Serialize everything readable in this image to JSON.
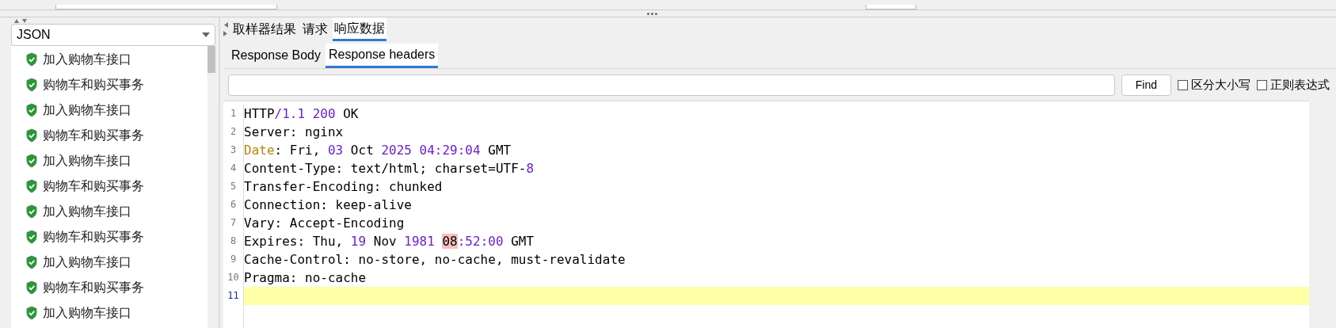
{
  "left_panel": {
    "renderer": {
      "value": "JSON"
    },
    "results": [
      {
        "label": "加入购物车接口",
        "passed": true
      },
      {
        "label": "购物车和购买事务",
        "passed": true
      },
      {
        "label": "加入购物车接口",
        "passed": true
      },
      {
        "label": "购物车和购买事务",
        "passed": true
      },
      {
        "label": "加入购物车接口",
        "passed": true
      },
      {
        "label": "购物车和购买事务",
        "passed": true
      },
      {
        "label": "加入购物车接口",
        "passed": true
      },
      {
        "label": "购物车和购买事务",
        "passed": true
      },
      {
        "label": "加入购物车接口",
        "passed": true
      },
      {
        "label": "购物车和购买事务",
        "passed": true
      },
      {
        "label": "加入购物车接口",
        "passed": true
      }
    ]
  },
  "tabs": [
    {
      "label": "取样器结果",
      "selected": false
    },
    {
      "label": "请求",
      "selected": false
    },
    {
      "label": "响应数据",
      "selected": true
    }
  ],
  "sub_tabs": [
    {
      "label": "Response Body",
      "selected": false
    },
    {
      "label": "Response headers",
      "selected": true
    }
  ],
  "search": {
    "button": "Find",
    "options": [
      {
        "label": "区分大小写",
        "checked": false
      },
      {
        "label": "正则表达式",
        "checked": false
      }
    ]
  },
  "editor": {
    "lines": [
      {
        "number": "1",
        "current": false,
        "tokens": [
          {
            "text": "HTTP",
            "kind": "plain"
          },
          {
            "text": "/1.1 200",
            "kind": "number"
          },
          {
            "text": " OK",
            "kind": "plain"
          }
        ]
      },
      {
        "number": "2",
        "current": false,
        "tokens": [
          {
            "text": "Server: nginx",
            "kind": "plain"
          }
        ]
      },
      {
        "number": "3",
        "current": false,
        "tokens": [
          {
            "text": "Date",
            "kind": "keyword"
          },
          {
            "text": ": Fri, ",
            "kind": "plain"
          },
          {
            "text": "03",
            "kind": "number"
          },
          {
            "text": " Oct ",
            "kind": "plain"
          },
          {
            "text": "2025 04:29:04",
            "kind": "number"
          },
          {
            "text": " GMT",
            "kind": "plain"
          }
        ]
      },
      {
        "number": "4",
        "current": false,
        "tokens": [
          {
            "text": "Content-Type: text/html; charset=UTF-",
            "kind": "plain"
          },
          {
            "text": "8",
            "kind": "number"
          }
        ]
      },
      {
        "number": "5",
        "current": false,
        "tokens": [
          {
            "text": "Transfer-Encoding: chunked",
            "kind": "plain"
          }
        ]
      },
      {
        "number": "6",
        "current": false,
        "tokens": [
          {
            "text": "Connection: keep-alive",
            "kind": "plain"
          }
        ]
      },
      {
        "number": "7",
        "current": false,
        "tokens": [
          {
            "text": "Vary: Accept-Encoding",
            "kind": "plain"
          }
        ]
      },
      {
        "number": "8",
        "current": false,
        "tokens": [
          {
            "text": "Expires: Thu, ",
            "kind": "plain"
          },
          {
            "text": "19",
            "kind": "number"
          },
          {
            "text": " Nov ",
            "kind": "plain"
          },
          {
            "text": "1981 ",
            "kind": "number"
          },
          {
            "text": "08",
            "kind": "match"
          },
          {
            "text": ":52:00",
            "kind": "number"
          },
          {
            "text": " GMT",
            "kind": "plain"
          }
        ]
      },
      {
        "number": "9",
        "current": false,
        "tokens": [
          {
            "text": "Cache-Control: no-store, no-cache, must-revalidate",
            "kind": "plain"
          }
        ]
      },
      {
        "number": "10",
        "current": false,
        "tokens": [
          {
            "text": "Pragma: no-cache",
            "kind": "plain"
          }
        ]
      },
      {
        "number": "11",
        "current": true
      }
    ]
  }
}
